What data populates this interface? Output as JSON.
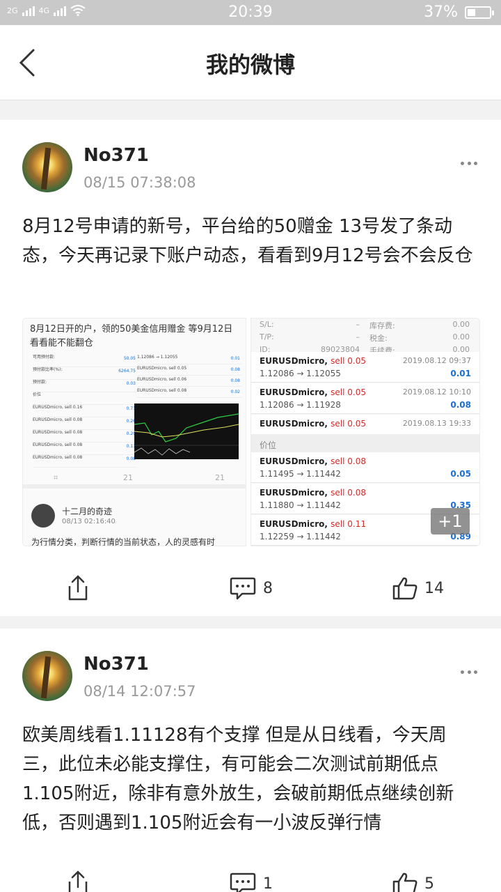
{
  "status_bar": {
    "network_1": "2G",
    "network_2": "4G",
    "time": "20:39",
    "battery_percent": "37%",
    "battery_level": 0.37
  },
  "nav": {
    "title": "我的微博",
    "back_icon": "chevron-left-icon"
  },
  "posts": [
    {
      "user": "No371",
      "time": "08/15 07:38:08",
      "text": "8月12号申请的新号，平台给的50赠金 13号发了条动态，今天再记录下账户动态，看看到9月12号会不会反仓",
      "image1": {
        "caption": "8月12日开的户，领的50美金信用赠金 等9月12日看看能不能翻仓",
        "rows": [
          {
            "label": "可用预付款:",
            "value": "50.05"
          },
          {
            "label": "预付款比率(%):",
            "value": "6264.75"
          },
          {
            "label": "预付款:",
            "value": "0.03"
          },
          {
            "label": "价位",
            "value": ""
          },
          {
            "label": "EURUSDmicro, sell 0.16",
            "value": "0.73"
          },
          {
            "label": "EURUSDmicro, sell 0.08",
            "value": "0.26"
          },
          {
            "label": "EURUSDmicro, sell 0.08",
            "value": "0.20"
          },
          {
            "label": "EURUSDmicro, sell 0.08",
            "value": "0.13"
          },
          {
            "label": "EURUSDmicro, sell 0.08",
            "value": "0.08"
          }
        ],
        "right_rows": [
          {
            "label": "1.12086 → 1.12055",
            "value": "0.01"
          },
          {
            "label": "EURUSDmicro, sell 0.05",
            "value": "0.08"
          },
          {
            "label": "EURUSDmicro, sell 0.06",
            "value": "0.08"
          },
          {
            "label": "EURUSDmicro, sell 0.08",
            "value": "0.02"
          }
        ],
        "comment_count": "21",
        "like_count": "21",
        "sub_user": "十二月的奇迹",
        "sub_time": "08/13 02:16:40",
        "sub_text": "为行情分类，判断行情的当前状态，人的灵感有时"
      },
      "image2": {
        "kv": [
          {
            "k": "S/L:",
            "v": "–",
            "k2": "库存费:",
            "v2": "0.00"
          },
          {
            "k": "T/P:",
            "v": "–",
            "k2": "税金:",
            "v2": "0.00"
          },
          {
            "k": "ID:",
            "v": "89023804",
            "k2": "手续费:",
            "v2": "0.00"
          }
        ],
        "trades_top": [
          {
            "symbol": "EURUSDmicro,",
            "side": "sell 0.05",
            "prices": "1.12086 → 1.12055",
            "date": "2019.08.12 09:37",
            "profit": "0.01"
          },
          {
            "symbol": "EURUSDmicro,",
            "side": "sell 0.05",
            "prices": "1.12086 → 1.11928",
            "date": "2019.08.12 10:10",
            "profit": "0.08"
          },
          {
            "symbol": "EURUSDmicro,",
            "side": "sell 0.05",
            "prices": "",
            "date": "2019.08.13 19:33",
            "profit": ""
          }
        ],
        "section": "价位",
        "trades_bottom": [
          {
            "symbol": "EURUSDmicro,",
            "side": "sell 0.08",
            "prices": "1.11495 → 1.11442",
            "date": "",
            "profit": "0.05"
          },
          {
            "symbol": "EURUSDmicro,",
            "side": "sell 0.08",
            "prices": "1.11880 → 1.11442",
            "date": "",
            "profit": "0.35"
          },
          {
            "symbol": "EURUSDmicro,",
            "side": "sell 0.11",
            "prices": "1.12259 → 1.11442",
            "date": "",
            "profit": "0.89"
          }
        ],
        "more_badge": "+1"
      },
      "comments": "8",
      "likes": "14"
    },
    {
      "user": "No371",
      "time": "08/14 12:07:57",
      "text": "欧美周线看1.11128有个支撑 但是从日线看，今天周三，此位未必能支撑住，有可能会二次测试前期低点1.105附近，除非有意外放生，会破前期低点继续创新低，否则遇到1.105附近会有一小波反弹行情",
      "comments": "1",
      "likes": "5"
    }
  ]
}
